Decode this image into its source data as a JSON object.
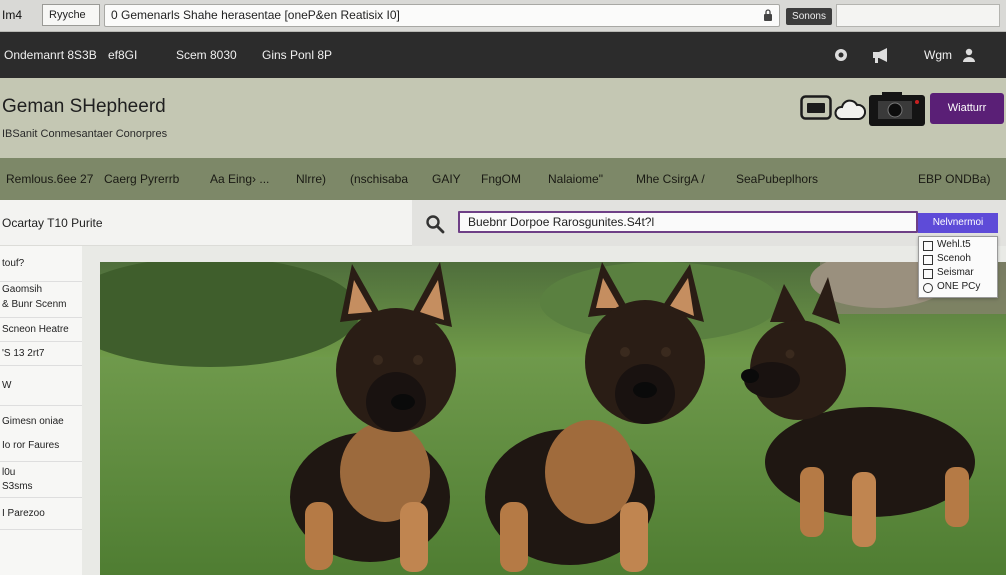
{
  "browser": {
    "tab_a": "Im4",
    "tab_b": "Ryyche",
    "url": "0 Gemenarls Shahe herasentae [oneP&en Reatisix I0]",
    "chip": "Sonons"
  },
  "topnav": {
    "items": [
      "Ondemanrt 8S3B",
      "ef8GI",
      "Scem 8030",
      "Gins Ponl 8P"
    ],
    "right_text": "Wgm"
  },
  "header": {
    "title": "Geman SHepheerd",
    "subtitle": "IBSanit Conmesantaer Conorpres",
    "button_label": "Wiatturr"
  },
  "catnav": {
    "items": [
      "Remlous.6ee 27",
      "Caerg Pyrerrb",
      "Aa Eing› ...",
      "Nlrre)",
      "(nschisaba",
      "GAIY",
      "FngOM",
      "Nalaiome\"",
      "Mhe CsirgA /",
      "SeaPubeplhors"
    ],
    "right": "EBP ONDBa)"
  },
  "search": {
    "heading": "Ocartay T10 Purite",
    "value": "Buebnr Dorpoe Rarosgunites.S4t?l",
    "button_label": "Nelvnermoi"
  },
  "dropdown": {
    "items": [
      "Wehl.t5",
      "Scenoh",
      "Seismar",
      "ONE PCy"
    ]
  },
  "sidebar": {
    "items": [
      "touf?",
      "Gaomsih",
      "& Bunr Scenm",
      "Scneon Heatre",
      "'S   13 2rt7",
      "W",
      "Gimesn oniae",
      "Io ror Faures",
      "l0u\nS3sms",
      "I Parezoo"
    ]
  },
  "colors": {
    "nav_dark": "#2c2c2c",
    "header_bg": "#c4c7b3",
    "catnav_bg": "#7d8868",
    "accent_purple": "#5a1f76",
    "search_button": "#5e4bd8"
  },
  "icons": [
    "menu-icon",
    "lock-icon",
    "browser-icon",
    "megaphone-icon",
    "user-icon",
    "tv-icon",
    "cloud-icon",
    "camera-icon",
    "search-icon"
  ]
}
